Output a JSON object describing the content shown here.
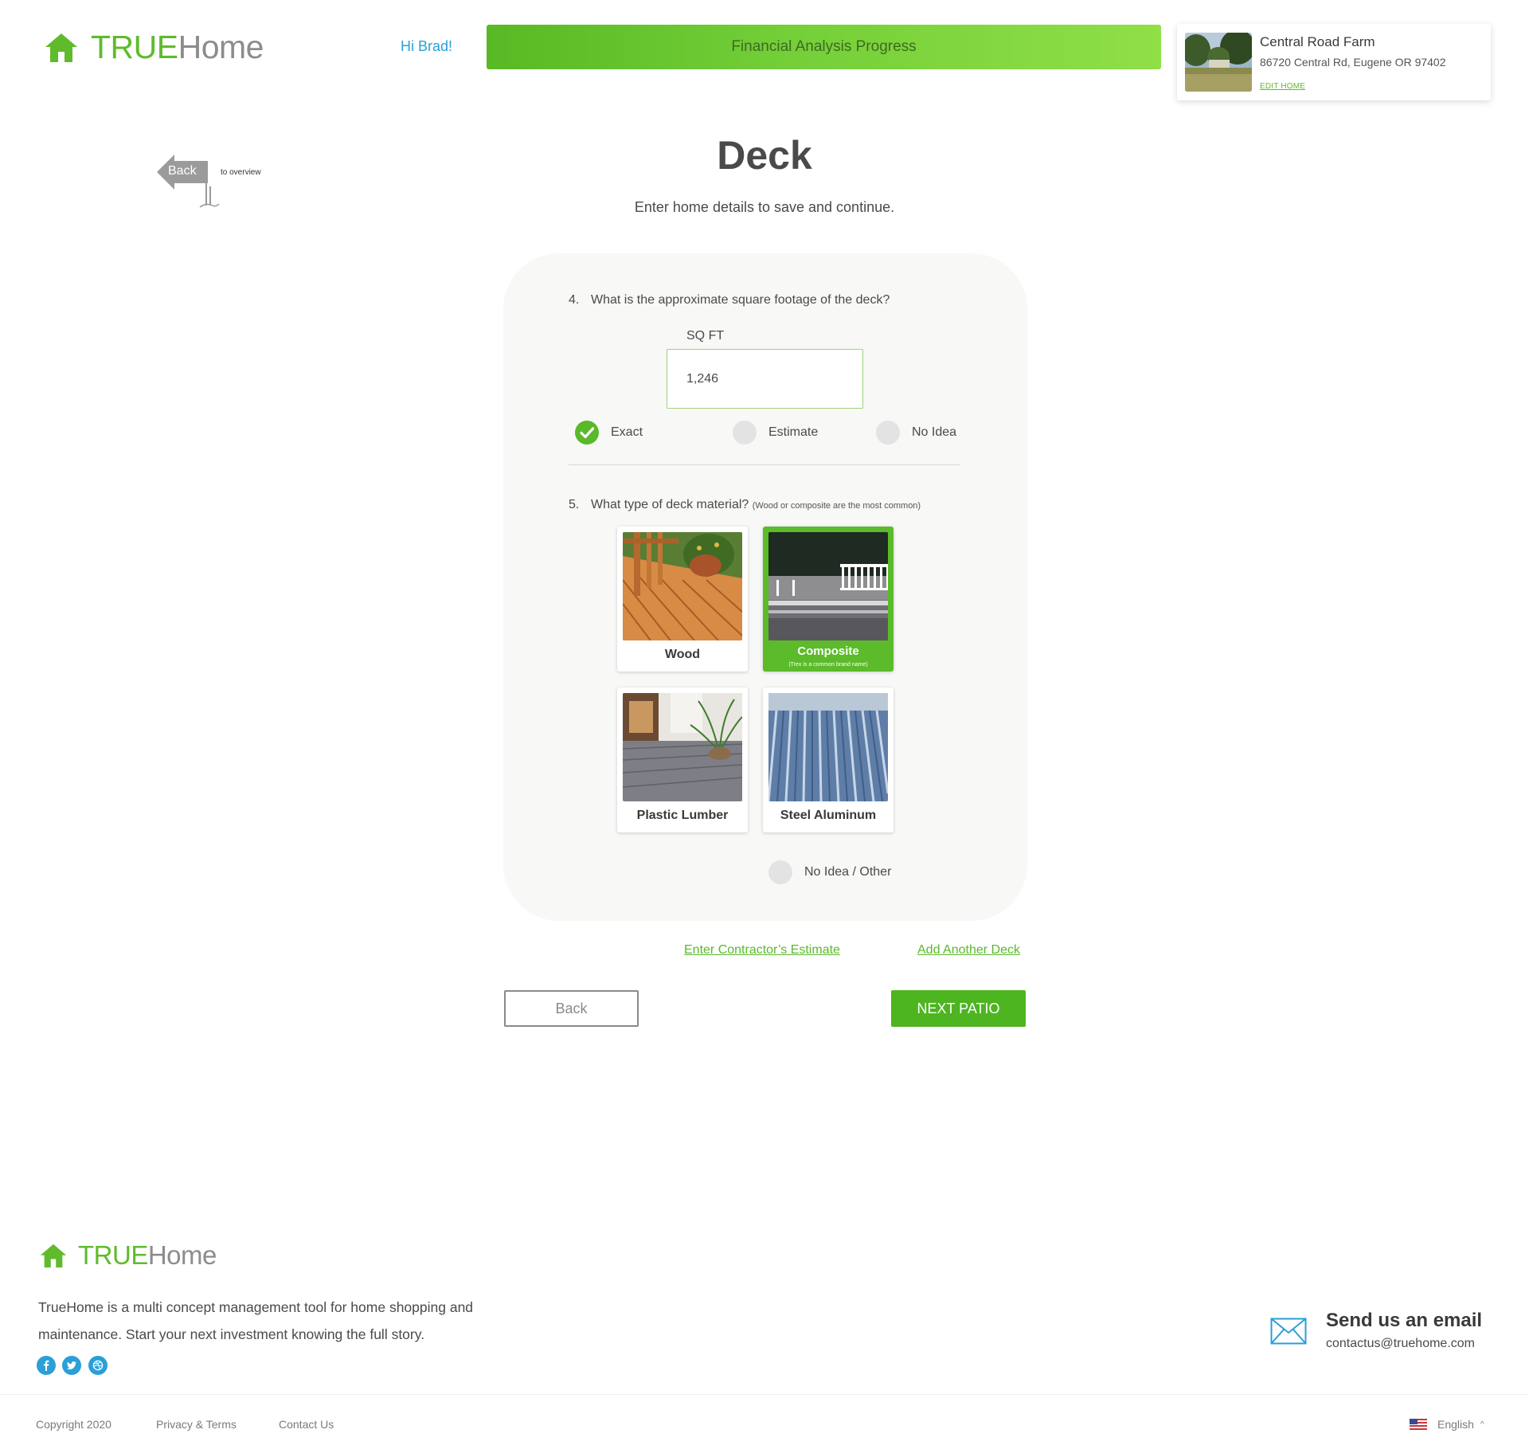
{
  "colors": {
    "brand_green": "#5fbb2c",
    "link_blue": "#2a9fd8",
    "panel_bg": "#f8f8f7",
    "text_dark": "#4a4a4a"
  },
  "header": {
    "logo": {
      "true_text": "TRUE",
      "home_text": "Home",
      "icon": "house-icon"
    },
    "greeting": "Hi Brad!",
    "progress": {
      "label": "Financial Analysis Progress",
      "fraction": 1.0
    },
    "home_card": {
      "name": "Central Road Farm",
      "address": "86720 Central Rd, Eugene OR 97402",
      "edit_label": "EDIT HOME"
    }
  },
  "back_flag": {
    "label": "Back",
    "sub_label": "to overview",
    "icon": "back-arrow-sign-icon"
  },
  "page": {
    "title": "Deck",
    "subtitle": "Enter home details to save and continue."
  },
  "form": {
    "q4": {
      "number": "4.",
      "text": "What is the approximate square footage of the deck?",
      "field_label": "SQ FT",
      "value": "1,246",
      "options": [
        {
          "label": "Exact",
          "checked": true
        },
        {
          "label": "Estimate",
          "checked": false
        },
        {
          "label": "No Idea",
          "checked": false
        }
      ]
    },
    "q5": {
      "number": "5.",
      "text": "What type of deck material?",
      "hint": "(Wood or composite are the most common)",
      "materials": [
        {
          "label": "Wood",
          "selected": false,
          "image": "wood-deck-photo"
        },
        {
          "label": "Composite",
          "note": "(Trex is a common brand name)",
          "selected": true,
          "image": "composite-deck-photo"
        },
        {
          "label": "Plastic Lumber",
          "selected": false,
          "image": "plastic-lumber-deck-photo"
        },
        {
          "label": "Steel Aluminum",
          "selected": false,
          "image": "steel-aluminum-deck-photo"
        }
      ],
      "other_option": {
        "label": "No Idea / Other",
        "checked": false
      }
    },
    "links": {
      "contractor": "Enter Contractor’s Estimate",
      "another_deck": "Add Another Deck"
    },
    "buttons": {
      "back": "Back",
      "next": "NEXT PATIO"
    }
  },
  "footer": {
    "logo": {
      "true_text": "TRUE",
      "home_text": "Home"
    },
    "description": "TrueHome is a multi concept management tool for home shopping and maintenance. Start your next investment knowing the full story.",
    "social": [
      "facebook-icon",
      "twitter-icon",
      "dribbble-icon"
    ],
    "email": {
      "title": "Send us an email",
      "address": "contactus@truehome.com",
      "icon": "envelope-icon"
    },
    "links": {
      "copyright": "Copyright 2020",
      "privacy": "Privacy & Terms",
      "contact": "Contact Us"
    },
    "language": {
      "label": "English",
      "flag": "us-flag-icon"
    }
  }
}
